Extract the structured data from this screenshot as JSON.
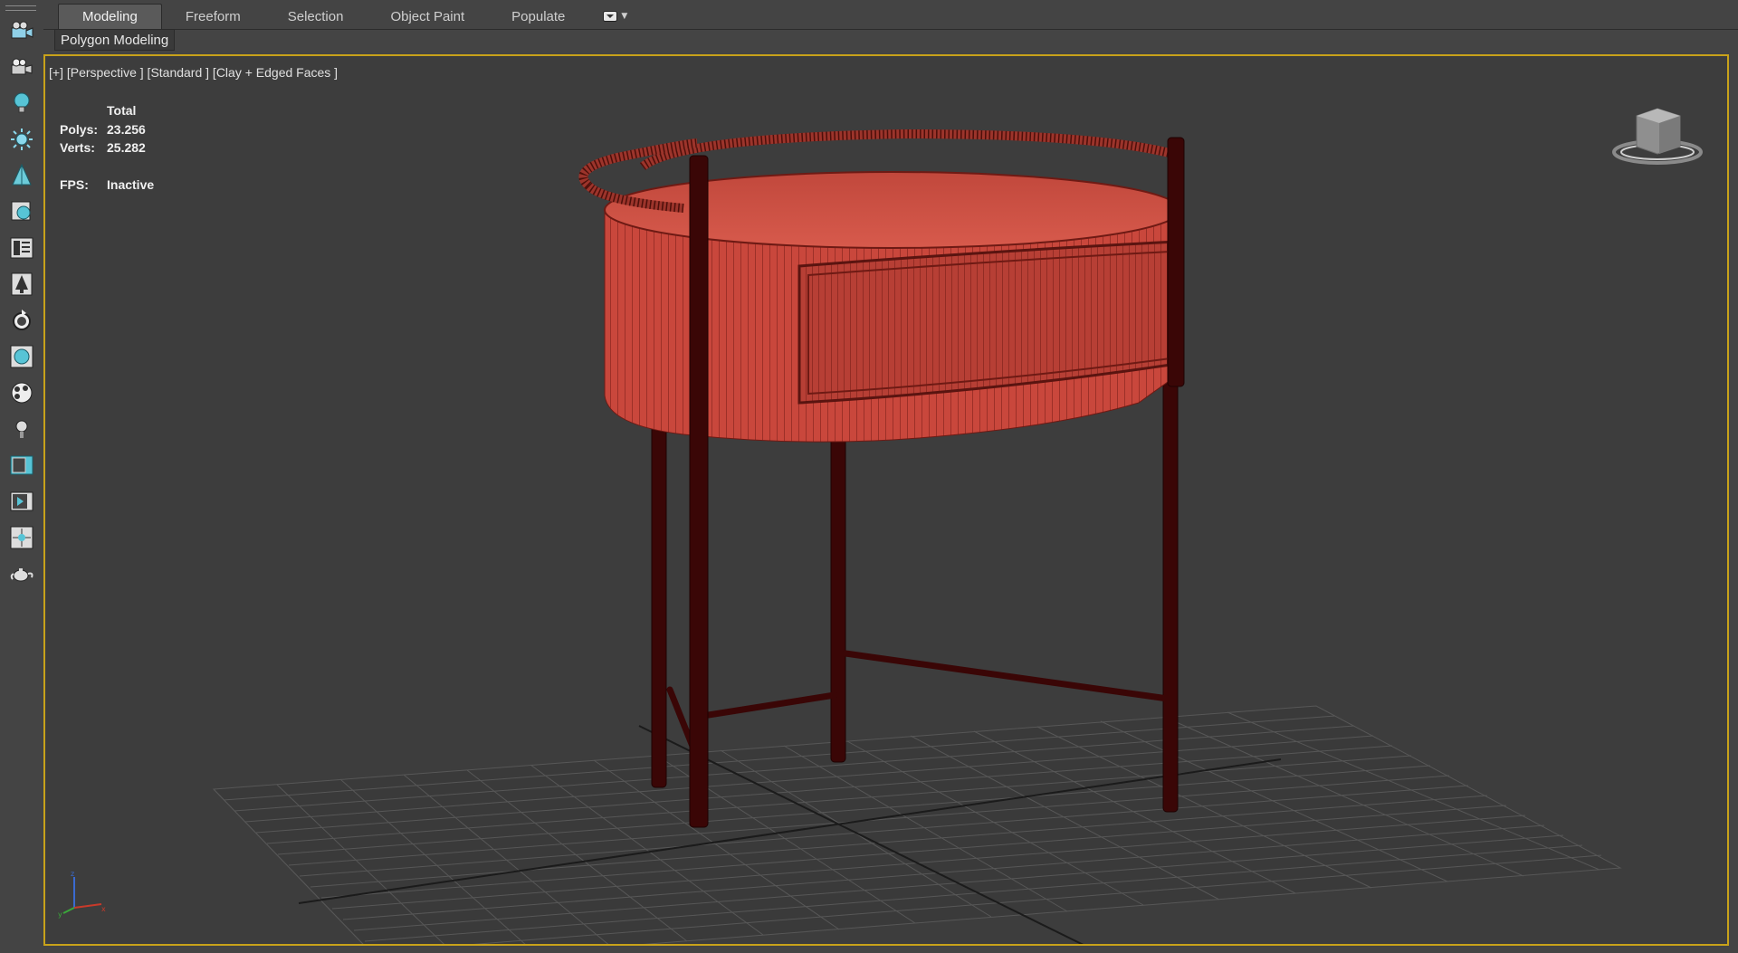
{
  "ribbon": {
    "tabs": [
      {
        "label": "Modeling",
        "active": true
      },
      {
        "label": "Freeform",
        "active": false
      },
      {
        "label": "Selection",
        "active": false
      },
      {
        "label": "Object Paint",
        "active": false
      },
      {
        "label": "Populate",
        "active": false
      }
    ],
    "overflow_icon": "ribbon-options-icon",
    "panel_label": "Polygon Modeling"
  },
  "left_toolbar": {
    "tools": [
      {
        "name": "camera-icon"
      },
      {
        "name": "render-camera-icon"
      },
      {
        "name": "light-bulb-icon"
      },
      {
        "name": "sun-icon"
      },
      {
        "name": "tree-icon"
      },
      {
        "name": "object-tool-icon"
      },
      {
        "name": "text-panel-icon"
      },
      {
        "name": "tree-brush-icon"
      },
      {
        "name": "cycle-icon"
      },
      {
        "name": "material-icon"
      },
      {
        "name": "paint-palette-icon"
      },
      {
        "name": "small-light-icon"
      },
      {
        "name": "viewport-layout-icon"
      },
      {
        "name": "render-frame-icon"
      },
      {
        "name": "grid-snap-icon"
      },
      {
        "name": "teapot-icon"
      }
    ]
  },
  "viewport": {
    "label": "[+] [Perspective ] [Standard ] [Clay + Edged Faces ]",
    "stats": {
      "header": "Total",
      "polys_label": "Polys:",
      "polys_value": "23.256",
      "verts_label": "Verts:",
      "verts_value": "25.282",
      "fps_label": "FPS:",
      "fps_value": "Inactive"
    },
    "viewcube_icon": "viewcube-icon",
    "axis_icon": "axis-tripod-icon",
    "colors": {
      "model_body": "#c9473c",
      "model_wire": "#6e1a14",
      "legs": "#3a0606",
      "grid": "#5a5a5a",
      "grid_axis": "#1b1b1b",
      "border_active": "#c8a21a"
    }
  }
}
